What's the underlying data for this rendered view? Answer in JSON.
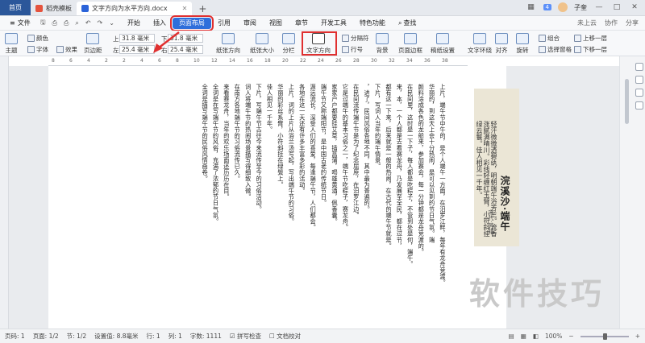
{
  "tabbar": {
    "home": "首页",
    "tabs": [
      {
        "label": "稻壳模板",
        "color": "#e5533d"
      },
      {
        "label": "文字方向为水平方向.docx",
        "color": "#2b63d9"
      }
    ],
    "add": "+",
    "badge": "4",
    "user": "子奎"
  },
  "menubar": {
    "file": "文件",
    "items": [
      "开始",
      "插入",
      "页面布局",
      "引用",
      "审阅",
      "视图",
      "章节",
      "开发工具",
      "特色功能"
    ],
    "active": "页面布局",
    "search": "查找",
    "right": [
      "未上云",
      "协作",
      "分享"
    ]
  },
  "ribbon": {
    "theme": "主题",
    "color": "颜色",
    "font": "字体",
    "effect": "效果",
    "margin": "页边距",
    "top_label": "上",
    "top_value": "31.8 毫米",
    "bottom_label": "下",
    "bottom_value": "31.8 毫米",
    "left_label": "左",
    "left_value": "25.4 毫米",
    "right_label": "右",
    "right_value": "25.4 毫米",
    "orientation": "纸张方向",
    "size": "纸张大小",
    "columns": "分栏",
    "text_direction": "文字方向",
    "line_number": "行号",
    "section_break": "分隔符",
    "background": "背景",
    "page_border": "页面边框",
    "paper_setting": "稿纸设置",
    "text_wrap": "文字环绕",
    "align": "对齐",
    "rotate": "旋转",
    "group": "组合",
    "up_layer": "上移一层",
    "down_layer": "下移一层",
    "select_pane": "选择窗格"
  },
  "ruler": [
    "8",
    "6",
    "4",
    "2",
    "2",
    "4",
    "6",
    "8",
    "10",
    "12",
    "14",
    "16",
    "18",
    "20",
    "22",
    "24",
    "26",
    "28",
    "30",
    "32",
    "34",
    "36",
    "38"
  ],
  "document": {
    "columns": [
      "上片，端午节中午的，是个人端午一方面，在汨罗江畔，每年有龙舟竞渡。",
      "华丽的，到这天上会十分热闹，是可以见到的节日气氛。端",
      "颜料涂成各色的龙船来，参加赛会，每一分钟都是龙舟竞渡的。",
      "在民间里，这时是一下子，每人都是吃粽子，不管到处是何，端午。",
      "来，本，一个人都是去看赛龙舟，乃发展至全民，都在过节，",
      "都有这一下来，后来就是一般的热闹，在古代的端午节就是。",
      "下片，写词人当年的端午情景。",
      "，进了，民间风俗各地不同，其中最为普遍的。",
      "在民间流传端午节是为了纪念屈原，在汨罗江边。",
      "它是过端午的基本习俗之一，端午节吃粽子，赛龙舟。",
      "家家户户都要挂艾草，插菖蒲，喝雄黄酒，佩香囊。",
      "端午节又称端阳节，是中国古老的传统节日。",
      "源远流长，深受人们的喜爱，每逢端午节，人们都会。",
      "各地在这一天还有许多丰富多彩的活动。",
      "上片，词的上片从浴兰汤写起，写出端午节的习俗。",
      "华丽的彩丝系臂，小符斜挂在绿鬓上。",
      "佳人相见一千年。",
      "下片，写端午节古往今来流传至今的习俗活动。",
      "词人将端午节的热闹场景描写得细致入微。",
      "在南方各地端午节的习俗流传已久。",
      "来看赛龙舟，当年的欢乐场面还历历在目。",
      "全词是在写端午节的风俗，充满了浓郁的节日气氛。",
      "全词是描写端午节的民俗风情画卷。"
    ]
  },
  "poem": {
    "title": "浣溪沙·端午",
    "author": "宋代·苏轼",
    "body": "轻汗微微透碧纨，明朝端午浴芳兰。流香涨腻满晴川。彩线轻缠红玉臂，小符斜挂绿云鬟。佳人相见一千年。"
  },
  "watermark": "软件技巧",
  "status": {
    "page": "页码: 1",
    "pages": "页面: 1/2",
    "section": "节: 1/2",
    "setting": "设置值: 8.8毫米",
    "row": "行: 1",
    "col": "列: 1",
    "words": "字数: 1111",
    "spell": "拼写检查",
    "doc_check": "文档校对",
    "zoom": "100%"
  }
}
